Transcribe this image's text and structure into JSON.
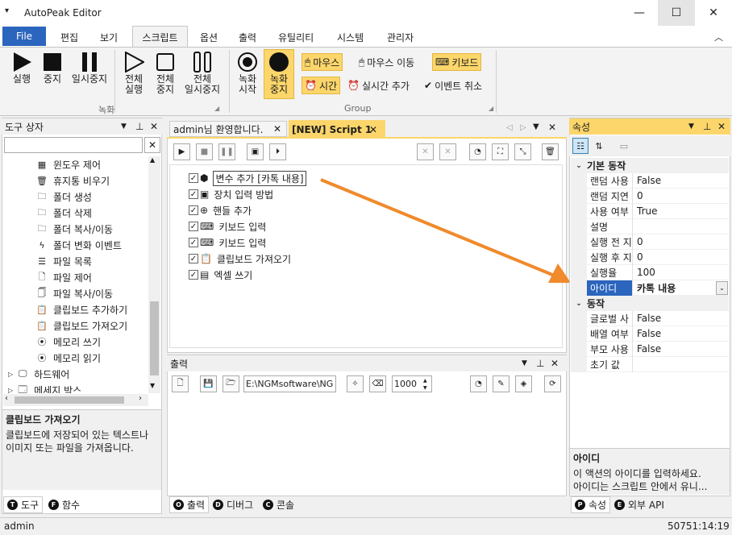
{
  "window": {
    "title": "AutoPeak Editor",
    "app_icon": "dropdown-arrow-icon"
  },
  "menu": {
    "file": "File",
    "tabs": [
      "편집",
      "보기",
      "스크립트",
      "옵션",
      "출력",
      "유틸리티",
      "시스템",
      "관리자"
    ],
    "active_tab": "스크립트"
  },
  "ribbon": {
    "run": "실행",
    "stop": "중지",
    "pause": "일시중지",
    "run_all_1": "전체",
    "run_all_2": "실행",
    "stop_all_1": "전체",
    "stop_all_2": "중지",
    "pause_all_1": "전체",
    "pause_all_2": "일시중지",
    "group1": "녹화",
    "rec_start_1": "녹화",
    "rec_start_2": "시작",
    "rec_stop_1": "녹화",
    "rec_stop_2": "중지",
    "mouse": "마우스",
    "mouse_move": "마우스 이동",
    "keyboard": "키보드",
    "time": "시간",
    "realtime_add": "실시간 추가",
    "event_cancel": "이벤트 취소",
    "group2": "Group"
  },
  "toolbox": {
    "title": "도구 상자",
    "items": [
      {
        "label": "윈도우 제어",
        "icon": "windows-icon"
      },
      {
        "label": "휴지통 비우기",
        "icon": "trash-icon"
      },
      {
        "label": "폴더 생성",
        "icon": "folder-add-icon"
      },
      {
        "label": "폴더 삭제",
        "icon": "folder-delete-icon"
      },
      {
        "label": "폴더 복사/이동",
        "icon": "folder-copy-icon"
      },
      {
        "label": "폴더 변화 이벤트",
        "icon": "lightning-icon"
      },
      {
        "label": "파일 목록",
        "icon": "list-icon"
      },
      {
        "label": "파일 제어",
        "icon": "file-icon"
      },
      {
        "label": "파일 복사/이동",
        "icon": "file-copy-icon"
      },
      {
        "label": "클립보드 추가하기",
        "icon": "clipboard-icon"
      },
      {
        "label": "클립보드 가져오기",
        "icon": "clipboard-icon"
      },
      {
        "label": "메모리 쓰기",
        "icon": "memory-icon"
      },
      {
        "label": "메모리 읽기",
        "icon": "memory-icon"
      },
      {
        "label": "하드웨어",
        "icon": "monitor-icon"
      },
      {
        "label": "메세지 박스",
        "icon": "message-icon"
      }
    ],
    "desc_title": "클립보드 가져오기",
    "desc_text": "클립보드에 저장되어 있는 텍스트나 이미지 또는 파일을 가져옵니다.",
    "tab_tools": "도구",
    "tab_functions": "함수"
  },
  "doc_tabs": {
    "welcome": "admin님 환영합니다.",
    "script": "[NEW] Script 1"
  },
  "script_items": [
    {
      "label": "변수 추가 [카톡 내용]",
      "icon": "cube-icon"
    },
    {
      "label": "장치 입력 방법",
      "icon": "device-icon"
    },
    {
      "label": "핸들 추가",
      "icon": "crosshair-icon"
    },
    {
      "label": "키보드 입력",
      "icon": "keyboard-icon"
    },
    {
      "label": "키보드 입력",
      "icon": "keyboard-icon"
    },
    {
      "label": "클립보드 가져오기",
      "icon": "clipboard-icon"
    },
    {
      "label": "엑셀 쓰기",
      "icon": "excel-icon"
    }
  ],
  "output": {
    "title": "출력",
    "path": "E:\\NGMsoftware\\NG",
    "count": "1000",
    "tab_output": "출력",
    "tab_debug": "디버그",
    "tab_console": "콘솔"
  },
  "properties": {
    "title": "속성",
    "cat1": "기본 동작",
    "rows1": [
      {
        "name": "랜덤 사용",
        "value": "False"
      },
      {
        "name": "랜덤 지연",
        "value": "0"
      },
      {
        "name": "사용 여부",
        "value": "True"
      },
      {
        "name": "설명",
        "value": ""
      },
      {
        "name": "실행 전 지",
        "value": "0"
      },
      {
        "name": "실행 후 지",
        "value": "0"
      },
      {
        "name": "실행율",
        "value": "100"
      }
    ],
    "selected_name": "아이디",
    "selected_value": "카톡 내용",
    "cat2": "동작",
    "rows2": [
      {
        "name": "글로벌 사",
        "value": "False"
      },
      {
        "name": "배열 여부",
        "value": "False"
      },
      {
        "name": "부모 사용",
        "value": "False"
      },
      {
        "name": "초기 값",
        "value": ""
      }
    ],
    "desc_title": "아이디",
    "desc_line1": "이 액션의 아이디를 입력하세요.",
    "desc_line2": "아이디는 스크립트 안에서 유니...",
    "tab_props": "속성",
    "tab_api": "외부 API"
  },
  "status": {
    "user": "admin",
    "time": "50751:14:19"
  },
  "colors": {
    "accent": "#2b65bd",
    "highlight": "#fcd66b",
    "arrow": "#f08a2c"
  }
}
